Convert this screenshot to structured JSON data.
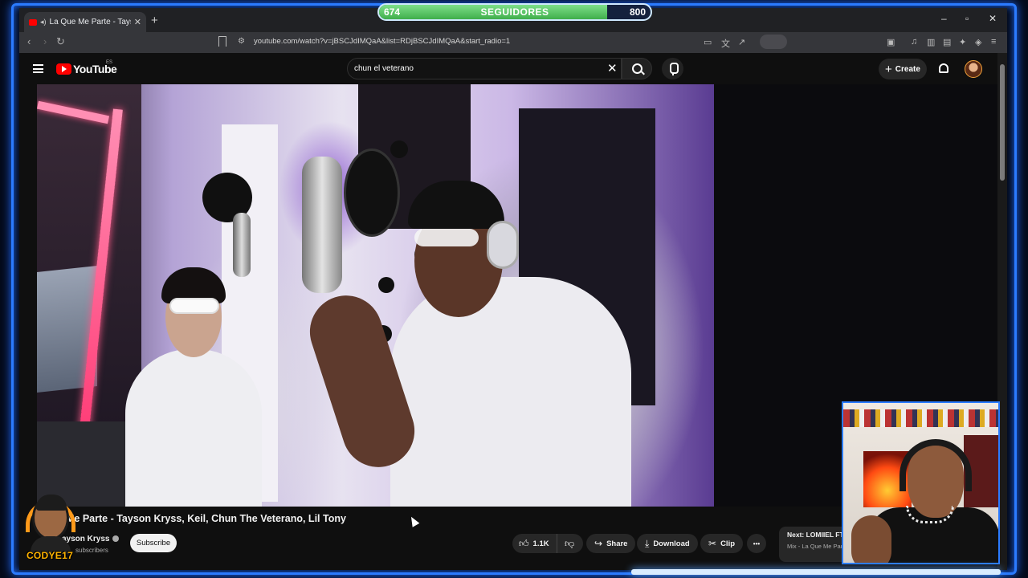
{
  "overlay": {
    "followers_current": "674",
    "followers_label": "SEGUIDORES",
    "followers_goal": "800",
    "progress": 0.84,
    "streamer_name": "CODYE17"
  },
  "browser": {
    "tab_title": "La Que Me Parte - Tayson Kry",
    "new_tab": "+",
    "url": "youtube.com/watch?v=jBSCJdIMQaA&list=RDjBSCJdIMQaA&start_radio=1",
    "minimize": "–",
    "restore": "▫",
    "close": "✕"
  },
  "youtube": {
    "logo_text": "YouTube",
    "country": "ES",
    "search_value": "chun el veterano",
    "clear": "✕",
    "create_label": "Create"
  },
  "video": {
    "title": "Me Parte - Tayson Kryss, Keil, Chun The Veterano, Lil Tony",
    "channel": "ayson Kryss",
    "subscribers": "subscribers",
    "subscribe_label": "Subscribe",
    "likes": "1.1K",
    "share_label": "Share",
    "download_label": "Download",
    "clip_label": "Clip",
    "more": "•••"
  },
  "up_next": {
    "title": "Next: LOMIIEL FT",
    "subtitle": "Mix - La Que Me Par"
  },
  "colors": {
    "accent_blue": "#2b7bff",
    "progress_green": "#4cc35a",
    "youtube_red": "#ff0000"
  }
}
